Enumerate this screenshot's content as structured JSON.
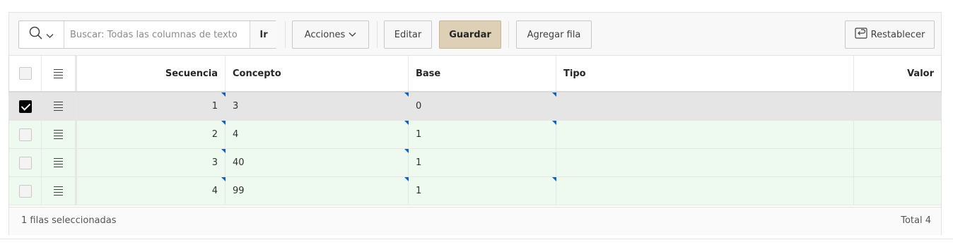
{
  "toolbar": {
    "search_placeholder": "Buscar: Todas las columnas de texto",
    "go_label": "Ir",
    "actions_label": "Acciones",
    "edit_label": "Editar",
    "save_label": "Guardar",
    "add_row_label": "Agregar fila",
    "reset_label": "Restablecer"
  },
  "columns": {
    "secuencia": "Secuencia",
    "concepto": "Concepto",
    "base": "Base",
    "tipo": "Tipo",
    "valor": "Valor"
  },
  "rows": [
    {
      "secuencia": "1",
      "concepto": "3",
      "base": "0",
      "tipo": "",
      "valor": "",
      "selected": true
    },
    {
      "secuencia": "2",
      "concepto": "4",
      "base": "1",
      "tipo": "",
      "valor": "",
      "selected": false
    },
    {
      "secuencia": "3",
      "concepto": "40",
      "base": "1",
      "tipo": "",
      "valor": "",
      "selected": false
    },
    {
      "secuencia": "4",
      "concepto": "99",
      "base": "1",
      "tipo": "",
      "valor": "",
      "selected": false
    }
  ],
  "footer": {
    "selection_text": "1 filas seleccionadas",
    "total_text": "Total 4"
  },
  "icons": {
    "search": "search-icon",
    "chevron": "chevron-down-icon",
    "reset": "reset-icon",
    "row_menu": "row-menu-icon"
  },
  "colors": {
    "primary_button": "#ddd0b6",
    "selected_row": "#e5e5e5",
    "changed_row": "#eefaef",
    "change_marker": "#0a64c8"
  }
}
